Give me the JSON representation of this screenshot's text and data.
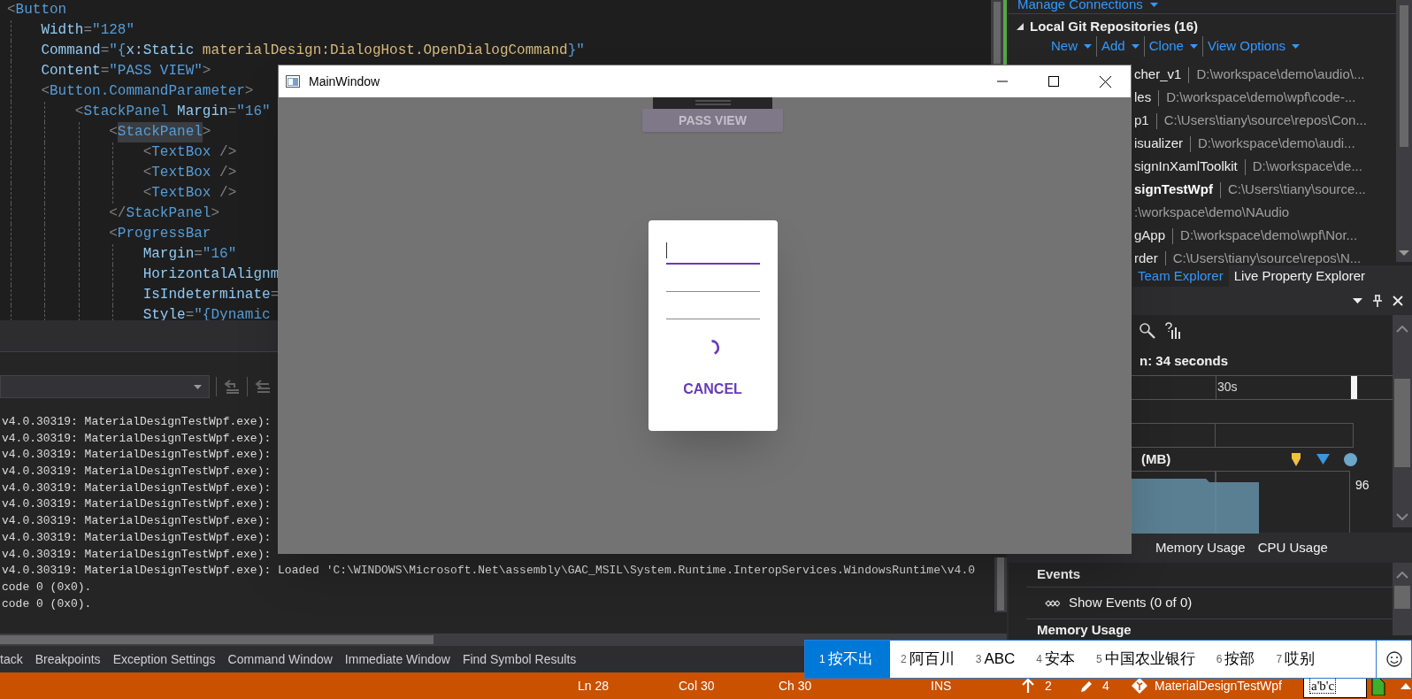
{
  "code_editor": {
    "lines": [
      {
        "segments": [
          {
            "kind": "p",
            "text": "<"
          },
          {
            "kind": "el",
            "text": "Button"
          }
        ],
        "children": [
          {
            "segments": [
              {
                "kind": "attr",
                "text": "Width"
              },
              {
                "kind": "p",
                "text": "="
              },
              {
                "kind": "val",
                "text": "\"128\""
              }
            ]
          },
          {
            "segments": [
              {
                "kind": "attr",
                "text": "Command"
              },
              {
                "kind": "p",
                "text": "="
              },
              {
                "kind": "val",
                "text": "\"{"
              },
              {
                "kind": "ext",
                "text": "x:Static"
              },
              {
                "kind": "ref",
                "text": " materialDesign:DialogHost.OpenDialogCommand"
              },
              {
                "kind": "val",
                "text": "}\""
              }
            ]
          },
          {
            "segments": [
              {
                "kind": "attr",
                "text": "Content"
              },
              {
                "kind": "p",
                "text": "="
              },
              {
                "kind": "val",
                "text": "\"PASS VIEW\""
              },
              {
                "kind": "p",
                "text": ">"
              }
            ]
          },
          {
            "segments": [
              {
                "kind": "p",
                "text": "<"
              },
              {
                "kind": "el",
                "text": "Button.CommandParameter"
              },
              {
                "kind": "p",
                "text": ">"
              }
            ],
            "children": [
              {
                "segments": [
                  {
                    "kind": "p",
                    "text": "<"
                  },
                  {
                    "kind": "el",
                    "text": "StackPanel"
                  },
                  {
                    "kind": "attr",
                    "text": " Margin"
                  },
                  {
                    "kind": "p",
                    "text": "="
                  },
                  {
                    "kind": "val",
                    "text": "\"16\""
                  }
                ],
                "children": [
                  {
                    "segments": [
                      {
                        "kind": "p",
                        "text": "<"
                      },
                      {
                        "kind": "el",
                        "text": "StackPanel",
                        "highlight": true
                      },
                      {
                        "kind": "p",
                        "text": ">"
                      }
                    ],
                    "children": [
                      {
                        "segments": [
                          {
                            "kind": "p",
                            "text": "<"
                          },
                          {
                            "kind": "el",
                            "text": "TextBox"
                          },
                          {
                            "kind": "p",
                            "text": " />"
                          }
                        ]
                      },
                      {
                        "segments": [
                          {
                            "kind": "p",
                            "text": "<"
                          },
                          {
                            "kind": "el",
                            "text": "TextBox"
                          },
                          {
                            "kind": "p",
                            "text": " />"
                          }
                        ]
                      },
                      {
                        "segments": [
                          {
                            "kind": "p",
                            "text": "<"
                          },
                          {
                            "kind": "el",
                            "text": "TextBox"
                          },
                          {
                            "kind": "p",
                            "text": " />"
                          }
                        ]
                      }
                    ]
                  },
                  {
                    "segments": [
                      {
                        "kind": "p",
                        "text": "</"
                      },
                      {
                        "kind": "el",
                        "text": "StackPanel"
                      },
                      {
                        "kind": "p",
                        "text": ">"
                      }
                    ]
                  },
                  {
                    "segments": [
                      {
                        "kind": "p",
                        "text": "<"
                      },
                      {
                        "kind": "el",
                        "text": "ProgressBar"
                      }
                    ],
                    "children": [
                      {
                        "segments": [
                          {
                            "kind": "attr",
                            "text": "Margin"
                          },
                          {
                            "kind": "p",
                            "text": "="
                          },
                          {
                            "kind": "val",
                            "text": "\"16\""
                          }
                        ]
                      },
                      {
                        "segments": [
                          {
                            "kind": "attr",
                            "text": "HorizontalAlignm"
                          }
                        ]
                      },
                      {
                        "segments": [
                          {
                            "kind": "attr",
                            "text": "IsIndeterminate"
                          },
                          {
                            "kind": "p",
                            "text": "="
                          }
                        ]
                      },
                      {
                        "segments": [
                          {
                            "kind": "attr",
                            "text": "Style"
                          },
                          {
                            "kind": "p",
                            "text": "="
                          },
                          {
                            "kind": "val",
                            "text": "\"{Dynamic"
                          }
                        ]
                      }
                    ]
                  }
                ]
              }
            ]
          }
        ]
      }
    ]
  },
  "output": {
    "lines": [
      "v4.0.30319: MaterialDesignTestWpf.exe):",
      "v4.0.30319: MaterialDesignTestWpf.exe):",
      "v4.0.30319: MaterialDesignTestWpf.exe):",
      "v4.0.30319: MaterialDesignTestWpf.exe):",
      "v4.0.30319: MaterialDesignTestWpf.exe):",
      "v4.0.30319: MaterialDesignTestWpf.exe):",
      "v4.0.30319: MaterialDesignTestWpf.exe):",
      "v4.0.30319: MaterialDesignTestWpf.exe):",
      "v4.0.30319: MaterialDesignTestWpf.exe):",
      "v4.0.30319: MaterialDesignTestWpf.exe): Loaded 'C:\\WINDOWS\\Microsoft.Net\\assembly\\GAC_MSIL\\System.Runtime.InteropServices.WindowsRuntime\\v4.0",
      "code 0 (0x0).",
      "code 0 (0x0)."
    ]
  },
  "bottom_tabs": [
    "tack",
    "Breakpoints",
    "Exception Settings",
    "Command Window",
    "Immediate Window",
    "Find Symbol Results"
  ],
  "team_explorer": {
    "manage_link": "Manage Connections",
    "section_title": "Local Git Repositories (16)",
    "expanded": true,
    "actions": [
      "New",
      "Add",
      "Clone",
      "View Options"
    ],
    "repositories": [
      {
        "name": "cher_v1",
        "path": "D:\\workspace\\demo\\audio\\...",
        "current": false
      },
      {
        "name": "les",
        "path": "D:\\workspace\\demo\\wpf\\code-...",
        "current": false
      },
      {
        "name": "p1",
        "path": "C:\\Users\\tiany\\source\\repos\\Con...",
        "current": false
      },
      {
        "name": "isualizer",
        "path": "D:\\workspace\\demo\\audi...",
        "current": false
      },
      {
        "name": "signInXamlToolkit",
        "path": "D:\\workspace\\de...",
        "current": false
      },
      {
        "name": "signTestWpf",
        "path": "C:\\Users\\tiany\\source...",
        "current": true
      },
      {
        "path": ":\\workspace\\demo\\NAudio"
      },
      {
        "name": "gApp",
        "path": "D:\\workspace\\demo\\wpf\\Nor...",
        "current": false
      },
      {
        "name": "rder",
        "path": "C:\\Users\\tiany\\source\\repos\\N...",
        "current": false
      }
    ],
    "tabs": [
      {
        "label": "Team Explorer",
        "selected": true
      },
      {
        "label": "Live Property Explorer",
        "selected": false
      }
    ]
  },
  "diagnostic_tools": {
    "duration": "n: 34 seconds",
    "ruler_label": "30s",
    "memory_label": "(MB)",
    "memory_max": "96",
    "tabs": [
      "Memory Usage",
      "CPU Usage"
    ],
    "events_title": "Events",
    "show_events": "Show Events (0 of 0)",
    "memory_title": "Memory Usage"
  },
  "main_window": {
    "title": "MainWindow",
    "background_button": "PASS VIEW",
    "dialog": {
      "fields": [
        {
          "focused": true
        },
        {
          "focused": false
        },
        {
          "focused": false
        }
      ],
      "cancel": "CANCEL"
    }
  },
  "ime": {
    "candidates": [
      {
        "number": "1",
        "text": "按不出",
        "selected": true
      },
      {
        "number": "2",
        "text": "阿百川",
        "selected": false
      },
      {
        "number": "3",
        "text": "ABC",
        "selected": false
      },
      {
        "number": "4",
        "text": "安本",
        "selected": false
      },
      {
        "number": "5",
        "text": "中国农业银行",
        "selected": false
      },
      {
        "number": "6",
        "text": "按部",
        "selected": false
      },
      {
        "number": "7",
        "text": "哎别",
        "selected": false
      }
    ],
    "composition": "a'b'c"
  },
  "status_bar": {
    "line": "Ln 28",
    "column": "Col 30",
    "char": "Ch 30",
    "mode": "INS",
    "pushes": "2",
    "changes": "4",
    "repository": "MaterialDesignTestWpf"
  }
}
